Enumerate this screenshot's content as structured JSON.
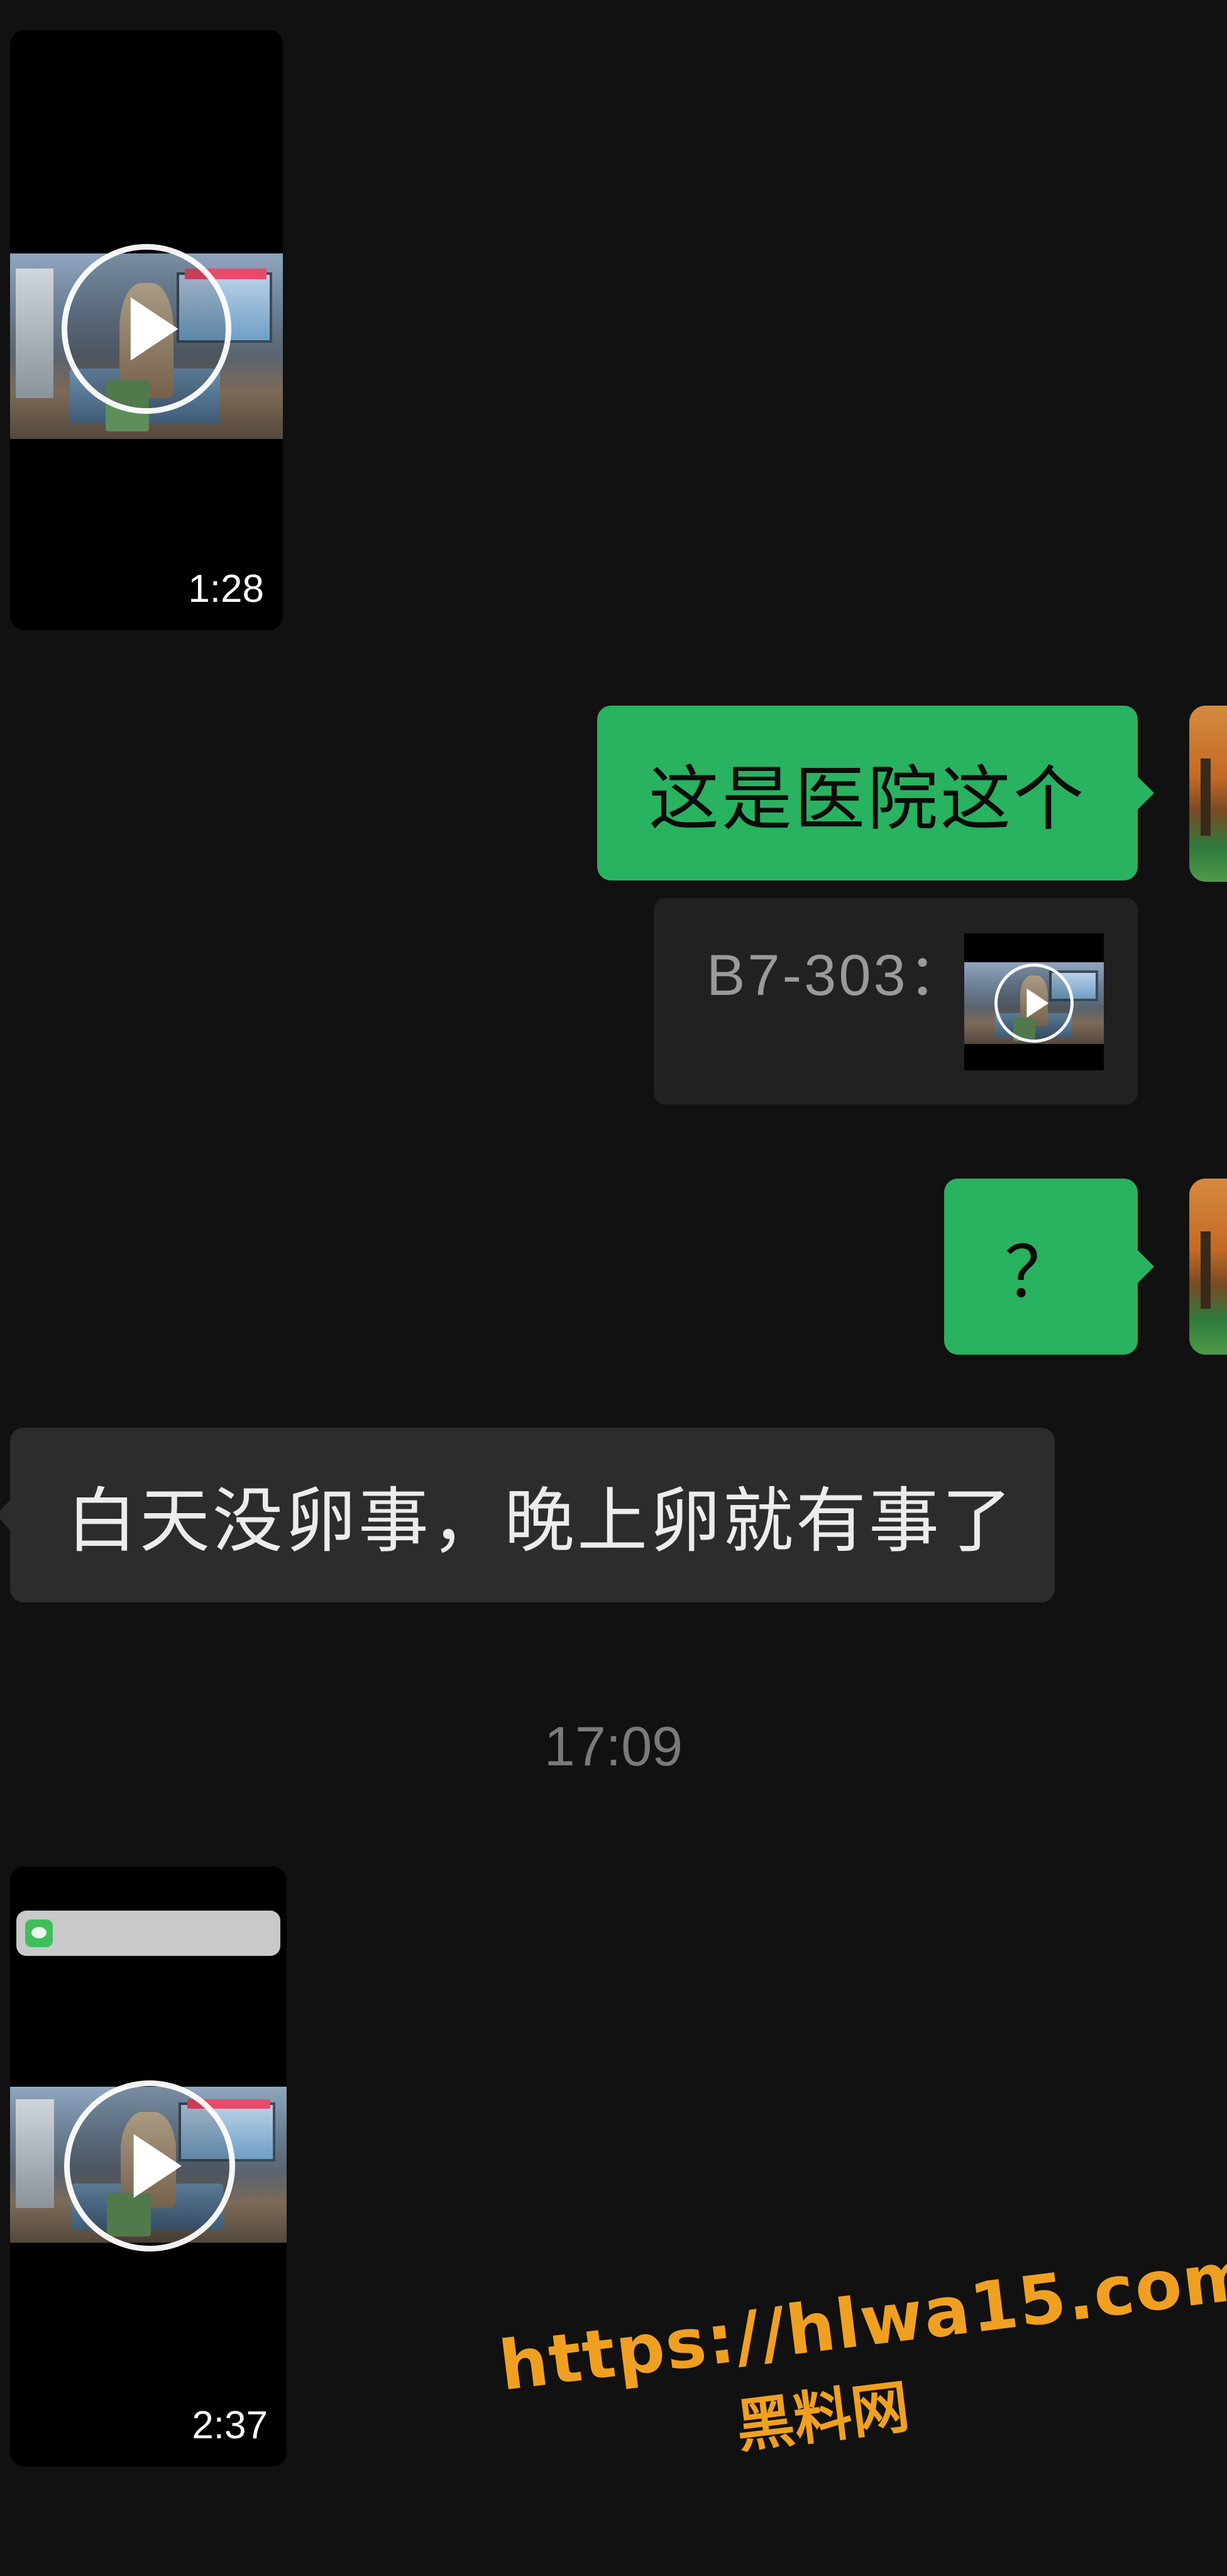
{
  "messages": {
    "video_1": {
      "duration": "1:28"
    },
    "text_1": {
      "text": "这是医院这个"
    },
    "quote_1": {
      "label": "B7-303："
    },
    "text_2": {
      "text": "？"
    },
    "text_3": {
      "text": "白天没卵事，晚上卵就有事了"
    },
    "timestamp_1": {
      "text": "17:09"
    },
    "video_2": {
      "duration": "2:37"
    }
  },
  "watermark": {
    "url": "https://hlwa15.com",
    "name": "黑料网"
  },
  "colors": {
    "background": "#111111",
    "outgoing_bubble": "#29b25f",
    "incoming_bubble": "#2c2c2c",
    "watermark": "#f0a021"
  }
}
